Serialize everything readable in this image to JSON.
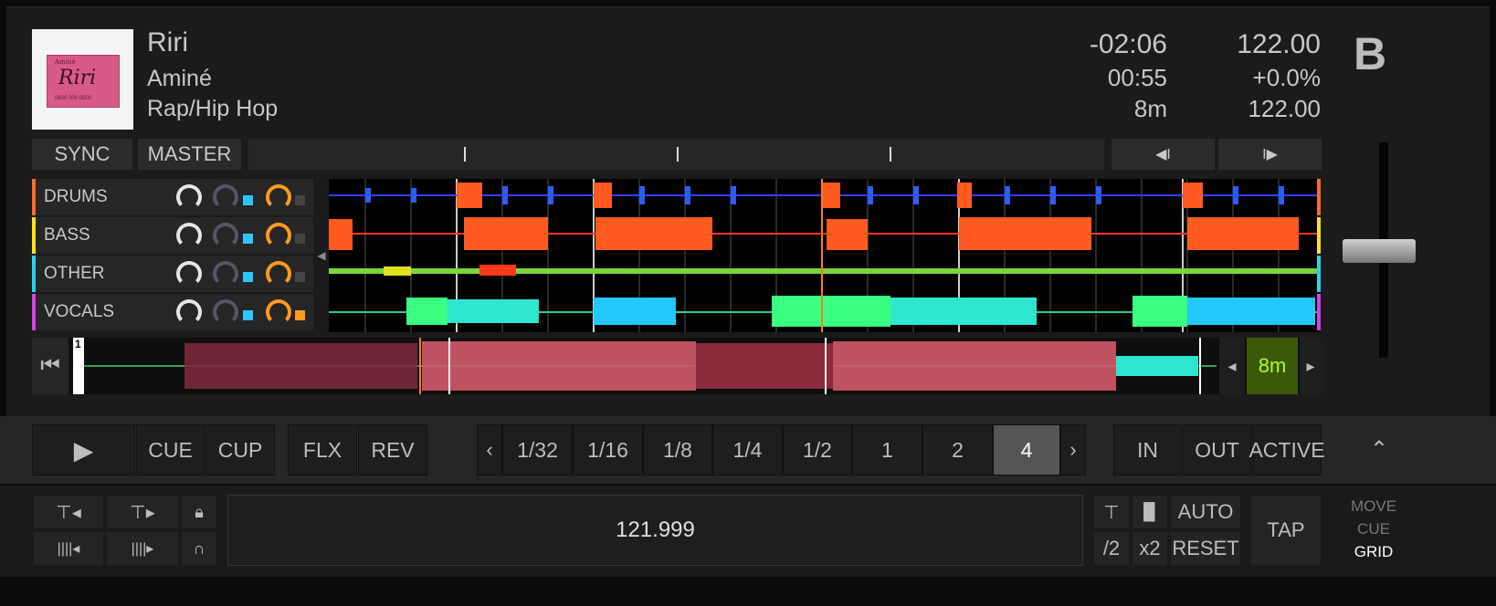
{
  "deck": {
    "letter": "B",
    "track": {
      "title": "Riri",
      "artist": "Aminé",
      "genre": "Rap/Hip Hop"
    },
    "times": {
      "remaining": "-02:06",
      "elapsed": "00:55",
      "key": "8m"
    },
    "tempo": {
      "bpm": "122.00",
      "pitch": "+0.0%",
      "original_bpm": "122.00"
    },
    "cover_text": {
      "small": "Aminé",
      "main": "Riri",
      "footer": "0800 000 0000"
    }
  },
  "controls": {
    "sync": "SYNC",
    "master": "MASTER",
    "beatjump_back": "◀I",
    "beatjump_fwd": "I▶"
  },
  "stems": [
    {
      "name": "DRUMS",
      "color": "#ff6a2a",
      "square": "#2fc4ff",
      "square2": "#444444"
    },
    {
      "name": "BASS",
      "color": "#ffe21a",
      "square": "#2fc4ff",
      "square2": "#444444"
    },
    {
      "name": "OTHER",
      "color": "#22d8e8",
      "square": "#2fc4ff",
      "square2": "#444444"
    },
    {
      "name": "VOCALS",
      "color": "#d63fe8",
      "square": "#2fc4ff",
      "square2": "#ff9a1f"
    }
  ],
  "overview": {
    "cue_number": "1",
    "key_display": "8m",
    "prev": "◂",
    "next": "▸"
  },
  "transport": {
    "play": "▶",
    "cue": "CUE",
    "cup": "CUP",
    "flx": "FLX",
    "rev": "REV",
    "loop_prev": "‹",
    "loop_next": "›",
    "loop_sizes": [
      "1/32",
      "1/16",
      "1/8",
      "1/4",
      "1/2",
      "1",
      "2",
      "4"
    ],
    "loop_active_index": 7,
    "in": "IN",
    "out": "OUT",
    "active": "ACTIVE",
    "collapse": "⌃"
  },
  "grid": {
    "bpm_value": "121.999",
    "auto": "AUTO",
    "reset": "RESET",
    "half": "/2",
    "double": "x2",
    "tap": "TAP",
    "mode": {
      "move": "MOVE",
      "cue": "CUE",
      "grid": "GRID"
    }
  },
  "colors": {
    "accent_green": "#b4ff1a",
    "orange": "#ff9a1f",
    "cyan": "#2fc4ff"
  }
}
